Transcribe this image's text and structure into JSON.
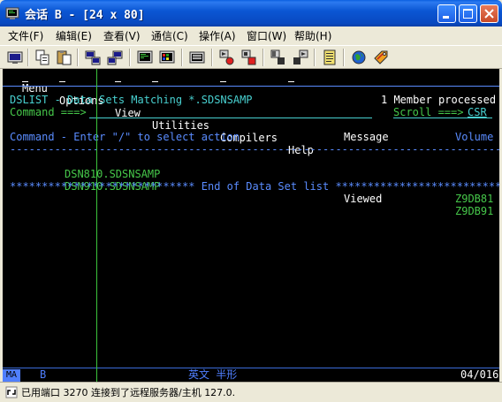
{
  "window": {
    "title": "会话 B - [24 x 80]",
    "controls": {
      "minimize_icon": "minimize-icon",
      "maximize_icon": "maximize-icon",
      "close_icon": "close-icon"
    }
  },
  "menubar": {
    "items": [
      {
        "label": "文件(F)"
      },
      {
        "label": "编辑(E)"
      },
      {
        "label": "查看(V)"
      },
      {
        "label": "通信(C)"
      },
      {
        "label": "操作(A)"
      },
      {
        "label": "窗口(W)"
      },
      {
        "label": "帮助(H)"
      }
    ]
  },
  "toolbar": {
    "buttons": [
      {
        "icon": "print-screen-icon"
      },
      {
        "icon": "copy-icon"
      },
      {
        "icon": "paste-icon"
      },
      {
        "icon": "send-file-icon"
      },
      {
        "icon": "receive-file-icon"
      },
      {
        "icon": "display-setup-icon"
      },
      {
        "icon": "color-map-icon"
      },
      {
        "icon": "keyboard-map-icon"
      },
      {
        "icon": "record-macro-icon"
      },
      {
        "icon": "stop-macro-icon"
      },
      {
        "icon": "play-macro-icon"
      },
      {
        "icon": "macro-list-icon"
      },
      {
        "icon": "notepad-icon"
      },
      {
        "icon": "globe-icon"
      },
      {
        "icon": "tag-icon"
      }
    ]
  },
  "terminal": {
    "action_bar": {
      "items": [
        "Menu",
        "Options",
        "View",
        "Utilities",
        "Compilers",
        "Help"
      ]
    },
    "header": {
      "title": "DSLIST - Data Sets Matching *.SDSNSAMP",
      "status": "1 Member processed",
      "command_label": "Command ===>",
      "command_value": "",
      "scroll_label": "Scroll ===>",
      "scroll_value": "CSR"
    },
    "columns": {
      "command": "Command - Enter \"/\" to select action",
      "message": "Message",
      "volume": "Volume"
    },
    "divider": "--------------------------------------------------------------------------------",
    "rows": [
      {
        "name": "DSN810.SDSNSAMP",
        "message": "",
        "volume": "Z9DB81"
      },
      {
        "name": "DSN910.SDSNSAMP",
        "message": "Viewed",
        "volume": "Z9DB91"
      }
    ],
    "end_marker": "***************************** End of Data Set list ****************************"
  },
  "oia": {
    "ma": "MA",
    "session": "B",
    "mode": "英文 半形",
    "cursor_pos": "04/016"
  },
  "statusbar": {
    "text": "已用端口 3270 连接到了远程服务器/主机 127.0."
  },
  "colors": {
    "title_gradient": "#0b57d4",
    "terminal_bg": "#000000",
    "terminal_white": "#ffffff",
    "terminal_blue": "#5a8cff",
    "terminal_turquoise": "#48d0d0",
    "terminal_green": "#46c84a"
  }
}
